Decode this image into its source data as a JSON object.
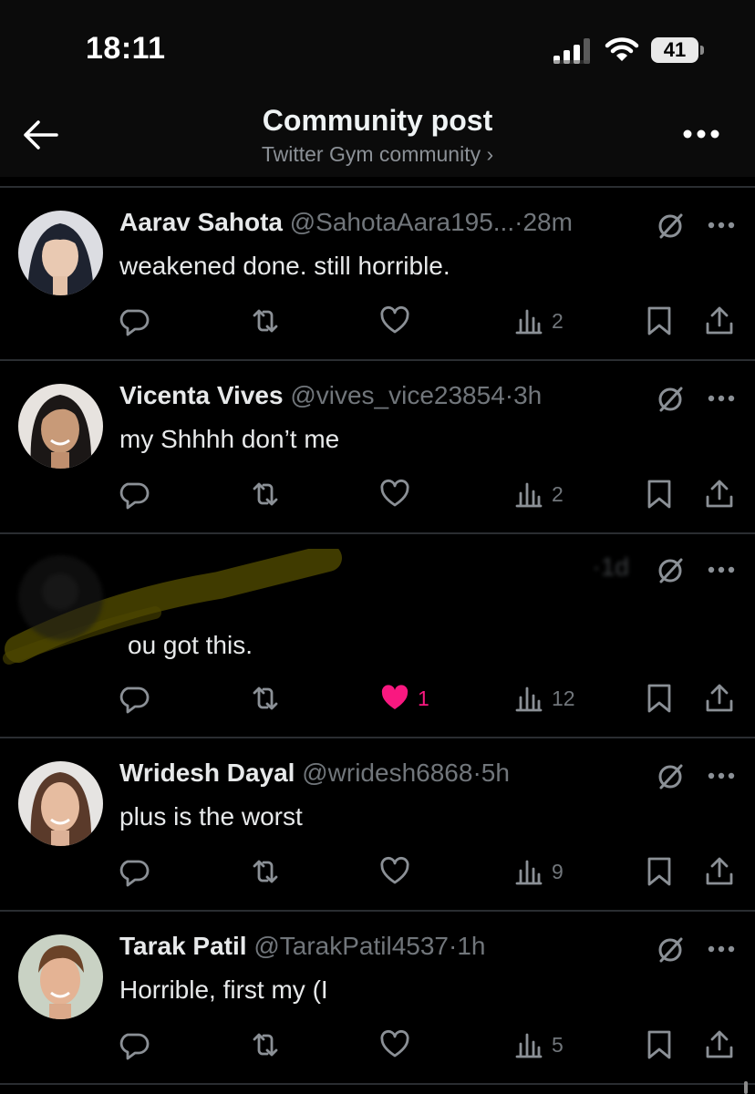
{
  "status_bar": {
    "time": "18:11",
    "battery": "41"
  },
  "header": {
    "title": "Community post",
    "subtitle": "Twitter Gym community ›",
    "back_icon": "arrow-left-icon",
    "more_icon": "more-horizontal-icon"
  },
  "posts": [
    {
      "name": "Aarav Sahota",
      "handle": "@SahotaAara195...",
      "sep": "·",
      "time": "28m",
      "text": "weakened done. still horrible.",
      "likes": "",
      "views": "2",
      "liked": false
    },
    {
      "name": "Vicenta Vives",
      "handle": "@vives_vice23854",
      "sep": "·",
      "time": "3h",
      "text": "my Shhhh don’t me",
      "likes": "",
      "views": "2",
      "liked": false
    },
    {
      "name": "",
      "handle": "",
      "sep": "·",
      "time": "1d",
      "text": "ou got this.",
      "likes": "1",
      "views": "12",
      "liked": true
    },
    {
      "name": "Wridesh Dayal",
      "handle": "@wridesh6868",
      "sep": "·",
      "time": "5h",
      "text": "plus is the worst",
      "likes": "",
      "views": "9",
      "liked": false
    },
    {
      "name": "Tarak Patil",
      "handle": "@TarakPatil4537",
      "sep": "·",
      "time": "1h",
      "text": "Horrible, first my (I",
      "likes": "",
      "views": "5",
      "liked": false
    }
  ],
  "colors": {
    "like_active": "#f91880",
    "text_secondary": "#71767b",
    "background": "#000000"
  }
}
